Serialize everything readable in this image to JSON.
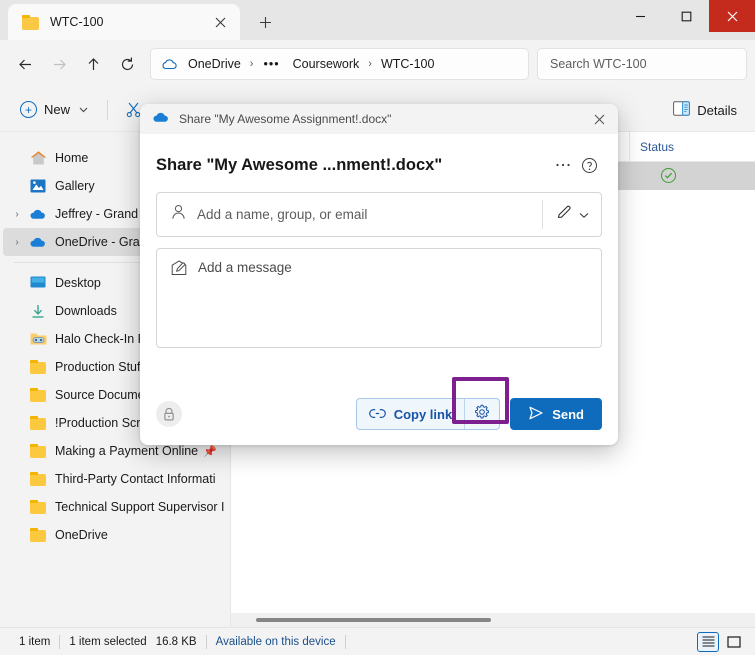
{
  "window": {
    "tab": {
      "title": "WTC-100",
      "folder_icon": "folder-icon",
      "close_icon": "close-icon",
      "new_tab_icon": "plus-icon"
    },
    "controls": {
      "minimize": "—",
      "maximize": "☐",
      "close": "✕"
    }
  },
  "nav": {
    "back_icon": "arrow-left-icon",
    "forward_icon": "arrow-right-icon",
    "up_icon": "arrow-up-icon",
    "refresh_icon": "refresh-icon",
    "breadcrumb": {
      "cloud_icon": "cloud-icon",
      "root": "OneDrive",
      "overflow": "•••",
      "items": [
        "Coursework",
        "WTC-100"
      ],
      "separator": "›"
    },
    "search": {
      "placeholder": "Search WTC-100",
      "value": "Search WTC-100"
    }
  },
  "commandbar": {
    "new_label": "New",
    "new_icon": "plus-circle-icon",
    "new_chevron": "ˇ",
    "cut_icon": "scissors-icon",
    "details_label": "Details",
    "details_icon": "details-pane-icon"
  },
  "sidebar": {
    "items": [
      {
        "label": "Home",
        "icon": "home-icon",
        "expandable": false,
        "selected": false,
        "pinned": false
      },
      {
        "label": "Gallery",
        "icon": "gallery-icon",
        "expandable": false,
        "selected": false,
        "pinned": false
      },
      {
        "label": "Jeffrey - Grand C",
        "icon": "cloud-icon",
        "expandable": true,
        "selected": false,
        "pinned": false
      },
      {
        "label": "OneDrive - Gran",
        "icon": "cloud-icon",
        "expandable": true,
        "selected": true,
        "pinned": false
      },
      {
        "label": "Desktop",
        "icon": "desktop-icon",
        "expandable": false,
        "selected": false,
        "pinned": false
      },
      {
        "label": "Downloads",
        "icon": "downloads-icon",
        "expandable": false,
        "selected": false,
        "pinned": false
      },
      {
        "label": "Halo Check-In F",
        "icon": "special-folder-icon",
        "expandable": false,
        "selected": false,
        "pinned": false
      },
      {
        "label": "Production Stuff",
        "icon": "folder-icon",
        "expandable": false,
        "selected": false,
        "pinned": false
      },
      {
        "label": "Source Documents",
        "icon": "folder-icon",
        "expandable": false,
        "selected": false,
        "pinned": true
      },
      {
        "label": "!Production Screenshots",
        "icon": "folder-icon",
        "expandable": false,
        "selected": false,
        "pinned": true
      },
      {
        "label": "Making a Payment Online",
        "icon": "folder-icon",
        "expandable": false,
        "selected": false,
        "pinned": true
      },
      {
        "label": "Third-Party Contact Informati",
        "icon": "folder-icon",
        "expandable": false,
        "selected": false,
        "pinned": false
      },
      {
        "label": "Technical Support Supervisor I",
        "icon": "folder-icon",
        "expandable": false,
        "selected": false,
        "pinned": false
      },
      {
        "label": "OneDrive",
        "icon": "folder-icon",
        "expandable": false,
        "selected": false,
        "pinned": false
      }
    ]
  },
  "filelist": {
    "columns": {
      "status": "Status"
    },
    "row": {
      "status_icon": "green-check-circle-icon"
    }
  },
  "dialog": {
    "titlebar_text": "Share \"My Awesome Assignment!.docx\"",
    "titlebar_icon": "onedrive-cloud-icon",
    "close_icon": "close-icon",
    "heading": "Share \"My Awesome ...nment!.docx\"",
    "more_icon": "more-options-icon",
    "more_label": "…",
    "help_icon": "help-circle-icon",
    "recipient": {
      "placeholder": "Add a name, group, or email",
      "value": "",
      "person_icon": "person-icon",
      "permission_icon": "pencil-icon",
      "permission_chevron_icon": "chevron-down-icon"
    },
    "message": {
      "placeholder": "Add a message",
      "value": "",
      "icon": "compose-icon"
    },
    "footer": {
      "lock_icon": "lock-icon",
      "copy_link_label": "Copy link",
      "copy_link_icon": "link-icon",
      "settings_icon": "gear-icon",
      "send_label": "Send",
      "send_icon": "send-arrow-icon"
    }
  },
  "highlight": {
    "color": "#7d1f8e",
    "target": "link-settings-gear-button"
  },
  "statusbar": {
    "item_count": "1 item",
    "selection": "1 item selected",
    "size": "16.8 KB",
    "sync_state": "Available on this device",
    "views": [
      {
        "icon": "details-view-icon",
        "active": true
      },
      {
        "icon": "large-icons-view-icon",
        "active": false
      }
    ]
  }
}
